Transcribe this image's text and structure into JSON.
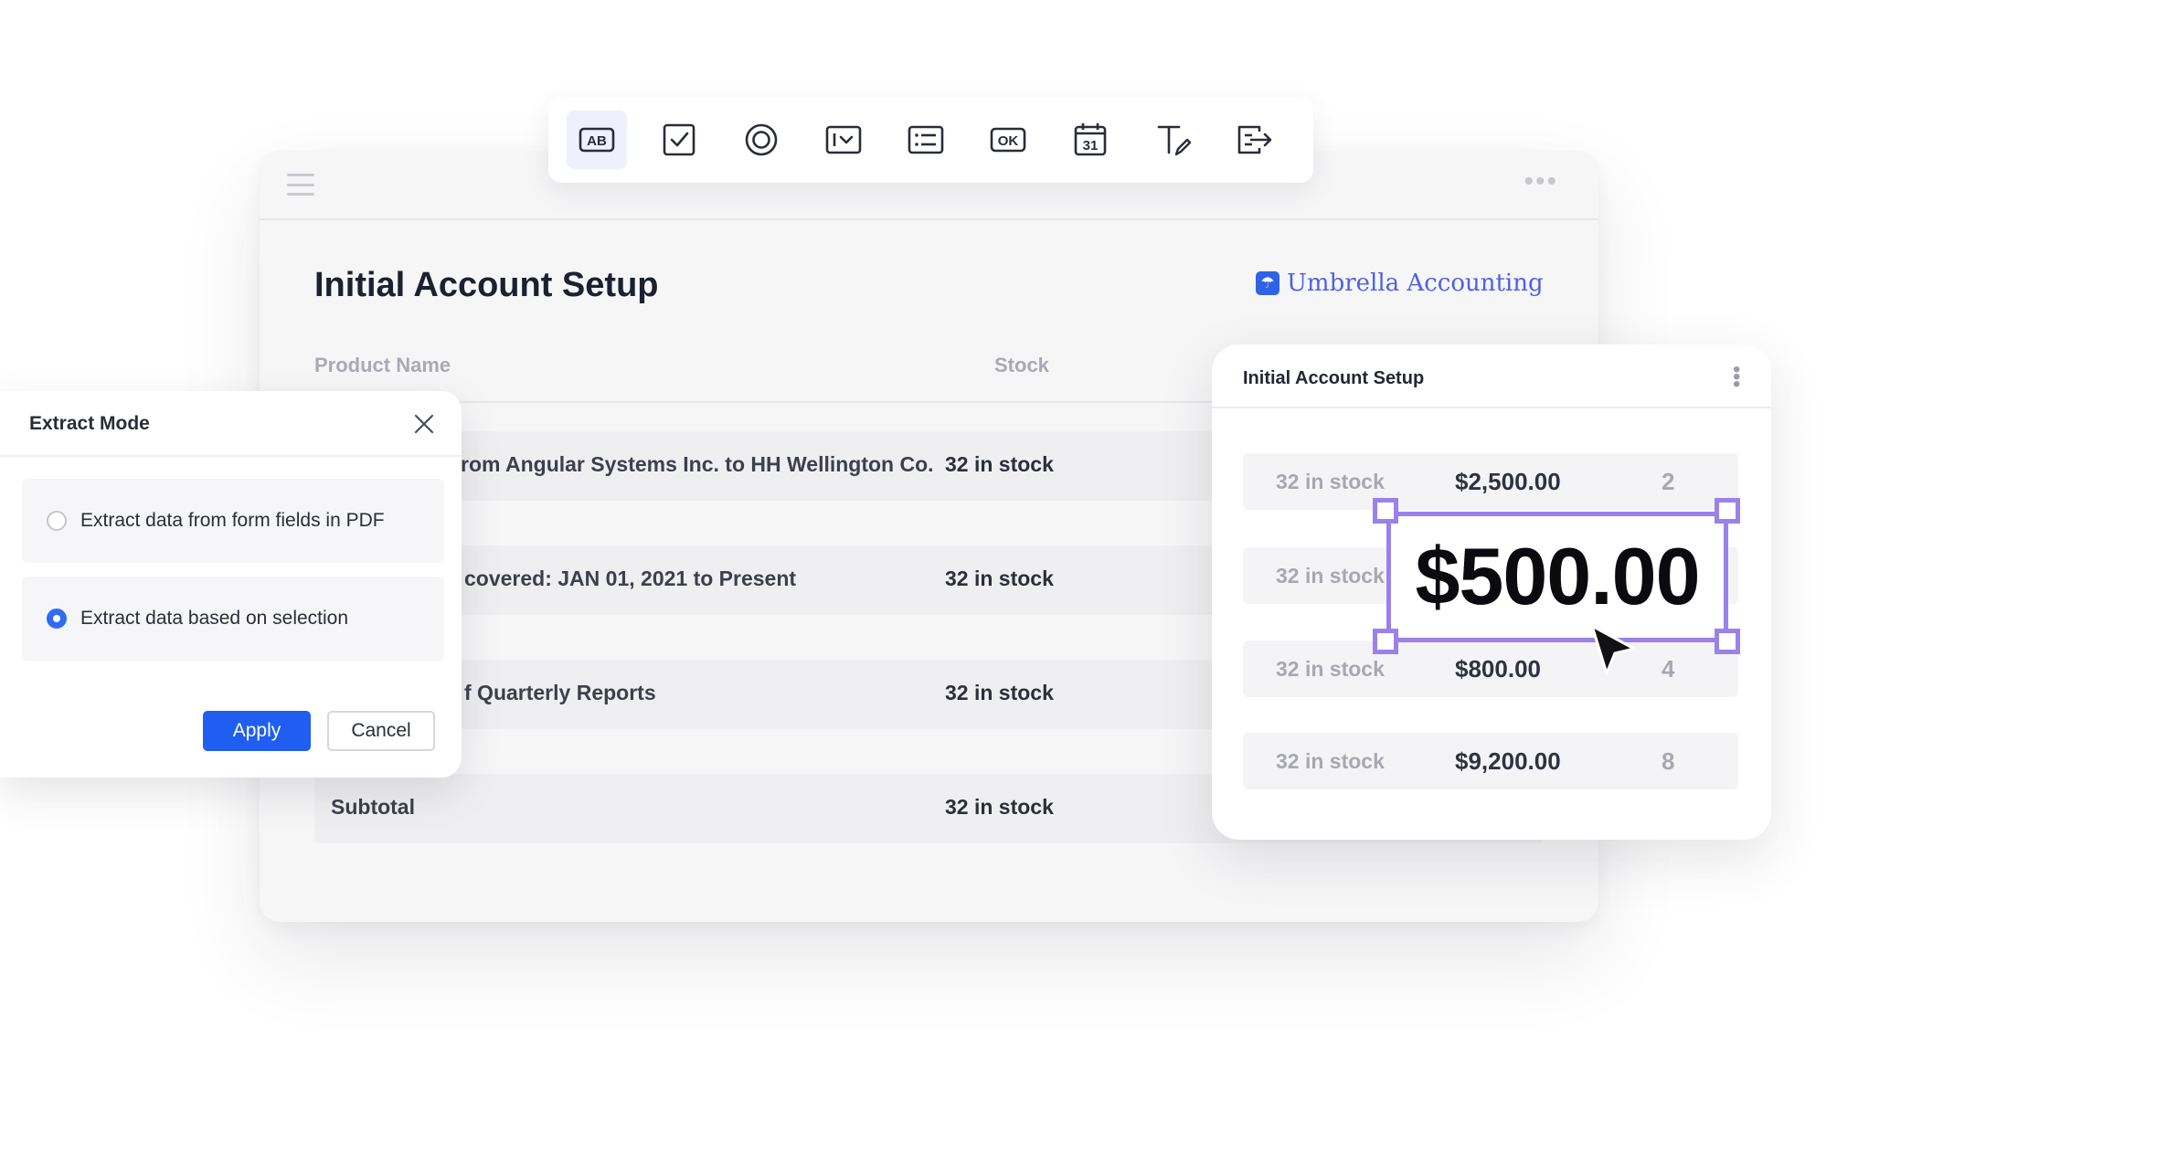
{
  "toolbar": {
    "tools": [
      {
        "name": "text-field-tool",
        "label": "AB"
      },
      {
        "name": "checkbox-tool"
      },
      {
        "name": "radio-tool"
      },
      {
        "name": "dropdown-tool"
      },
      {
        "name": "list-tool"
      },
      {
        "name": "button-tool",
        "label": "OK"
      },
      {
        "name": "date-tool",
        "label": "31"
      },
      {
        "name": "signature-tool"
      },
      {
        "name": "export-tool"
      }
    ],
    "active_tool": "text-field-tool"
  },
  "document": {
    "title": "Initial Account Setup",
    "brand": "Umbrella Accounting",
    "columns": {
      "product": "Product Name",
      "stock": "Stock"
    },
    "rows": [
      {
        "name": "rom Angular Systems Inc. to HH Wellington Co.",
        "stock": "32 in stock"
      },
      {
        "name": "covered: JAN 01, 2021 to Present",
        "stock": "32 in stock"
      },
      {
        "name": "f Quarterly Reports",
        "stock": "32 in stock"
      }
    ],
    "subtotal": {
      "label": "Subtotal",
      "stock": "32 in stock"
    }
  },
  "dialog": {
    "title": "Extract Mode",
    "options": [
      {
        "label": "Extract data from form fields in PDF",
        "selected": false
      },
      {
        "label": "Extract data based on selection",
        "selected": true
      }
    ],
    "apply_label": "Apply",
    "cancel_label": "Cancel"
  },
  "panel": {
    "title": "Initial Account Setup",
    "rows": [
      {
        "stock": "32 in stock",
        "amount": "$2,500.00",
        "qty": "2"
      },
      {
        "stock": "32 in stock",
        "amount": "",
        "qty": ""
      },
      {
        "stock": "32 in stock",
        "amount": "$800.00",
        "qty": "4"
      },
      {
        "stock": "32 in stock",
        "amount": "$9,200.00",
        "qty": "8"
      }
    ],
    "selection_value": "$500.00"
  },
  "colors": {
    "accent": "#1f5ef0",
    "selection": "#9a82ea",
    "brand": "#4d61e8"
  }
}
